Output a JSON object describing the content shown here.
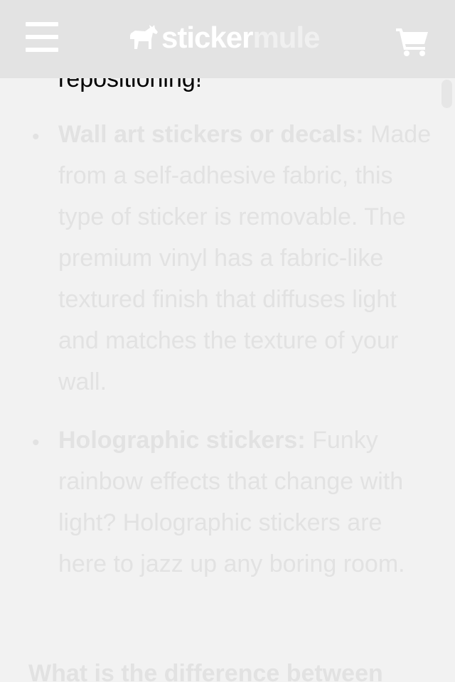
{
  "header": {
    "menu_icon": "hamburger-menu-icon",
    "logo": {
      "part1": "sticker",
      "part2": "mule",
      "mascot_icon": "mule-icon"
    },
    "cart_icon": "shopping-cart-icon",
    "colors": {
      "header_bg": "#e3e3e3",
      "icon": "#ffffff"
    }
  },
  "article": {
    "cut_paragraph_tail": "repositioning!",
    "items": [
      {
        "title": "Wall art stickers or decals:",
        "body": " Made from a self-adhesive fabric, this type of sticker is removable. The premium vinyl has a fabric-like textured finish that diffuses light and matches the texture of your wall."
      },
      {
        "title": "Holographic stickers:",
        "body": " Funky rainbow effects that change with light? Holographic stickers are here to jazz up any boring room."
      }
    ],
    "next_heading": "What is the difference between",
    "bullet_char": "•",
    "colors": {
      "background": "#f2f2f2",
      "text": "#e2e2e2"
    }
  }
}
